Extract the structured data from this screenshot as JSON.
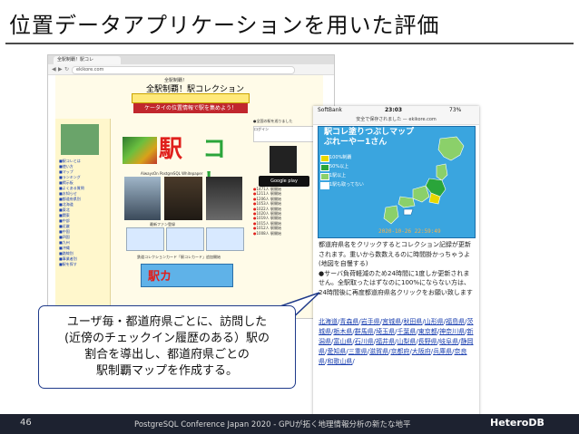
{
  "slide": {
    "title": "位置データアプリケーションを用いた評価",
    "page_number": "46",
    "footer_text": "PostgreSQL Conference Japan 2020 - GPUが拓く地理情報分析の新たな地平",
    "brand": "HeteroDB"
  },
  "browser": {
    "tab_label": "全駅制覇！駅コレ",
    "url": "ekikore.com",
    "site_sub": "全駅制覇！",
    "site_title": "全駅制覇！駅コレクション",
    "site_tagline": "ケータイの位置情報で駅を集めよう！",
    "center_note": "AlwaysOn PostgreSQL Whitepaper",
    "caption_photos": "最新ファン登録",
    "caption_cards": "鉄道コレクションカード「駅コレカード」追加開始",
    "banner2_text": "駅カ",
    "nav_items": [
      "駅コレとは",
      "使い方",
      "マップ",
      "ランキング",
      "掲示板",
      "よくある質問",
      "お知らせ",
      "都道府県別",
      "北海道",
      "東北",
      "関東",
      "中部",
      "近畿",
      "中国",
      "四国",
      "九州",
      "沖縄",
      "路線別",
      "事業者別",
      "駅を探す"
    ],
    "right_head": "●全国の駅を巡りました",
    "login_text": "ログイン",
    "gp_label": "Google play",
    "right_list": [
      "1471人 駅開始",
      "1211人 駅開始",
      "1206人 駅開始",
      "1053人 駅開始",
      "1022人 駅開始",
      "1020人 駅開始",
      "1019人 駅開始",
      "1015人 駅開始",
      "1012人 駅開始",
      "1008人 駅開始"
    ]
  },
  "phone": {
    "carrier": "SoftBank",
    "time": "23:03",
    "battery": "73%",
    "url": "安全で保存されました — ekikore.com",
    "map_title_line1": "駅コレ塗りつぶしマップ",
    "map_title_line2": "ぶれーやー1さん",
    "legend": [
      {
        "label": "100%制覇"
      },
      {
        "label": "50%以上"
      },
      {
        "label": "1駅以上"
      },
      {
        "label": "1駅も取ってない"
      }
    ],
    "map_timestamp": "2020-10-26 22:59:49",
    "body_text": "都道府県名をクリックするとコレクション記録が更新されます。重いから数数えるのに時間掛かっちゃうよ(地図を自慢する)",
    "body_link": "地図を自慢する",
    "body_text2": "●サーバ負荷軽減のため24時間に1度しか更新されません。全駅取ったはずなのに100%にならない方は、24時間後に再度都道府県名クリックをお願い致します",
    "prefectures": [
      "北海道",
      "青森県",
      "岩手県",
      "宮城県",
      "秋田県",
      "山形県",
      "福島県",
      "茨城県",
      "栃木県",
      "群馬県",
      "埼玉県",
      "千葉県",
      "東京都",
      "神奈川県",
      "新潟県",
      "富山県",
      "石川県",
      "福井県",
      "山梨県",
      "長野県",
      "岐阜県",
      "静岡県",
      "愛知県",
      "三重県",
      "滋賀県",
      "京都府",
      "大阪府",
      "兵庫県",
      "奈良県",
      "和歌山県"
    ]
  },
  "callout": {
    "line1": "ユーザ毎・都道府県ごとに、訪問した",
    "line2": "(近傍のチェックイン履歴のある）駅の",
    "line3": "割合を導出し、都道府県ごとの",
    "line4": "駅制覇マップを作成する。"
  },
  "colors": {
    "footer_bg": "#1d2230",
    "map_sea": "#3aa5df",
    "legend_100": "#e8d800",
    "legend_50": "#2aa53a",
    "legend_1": "#8bd06a",
    "legend_0": "#ffffff",
    "callout_border": "#1f3a8a"
  }
}
